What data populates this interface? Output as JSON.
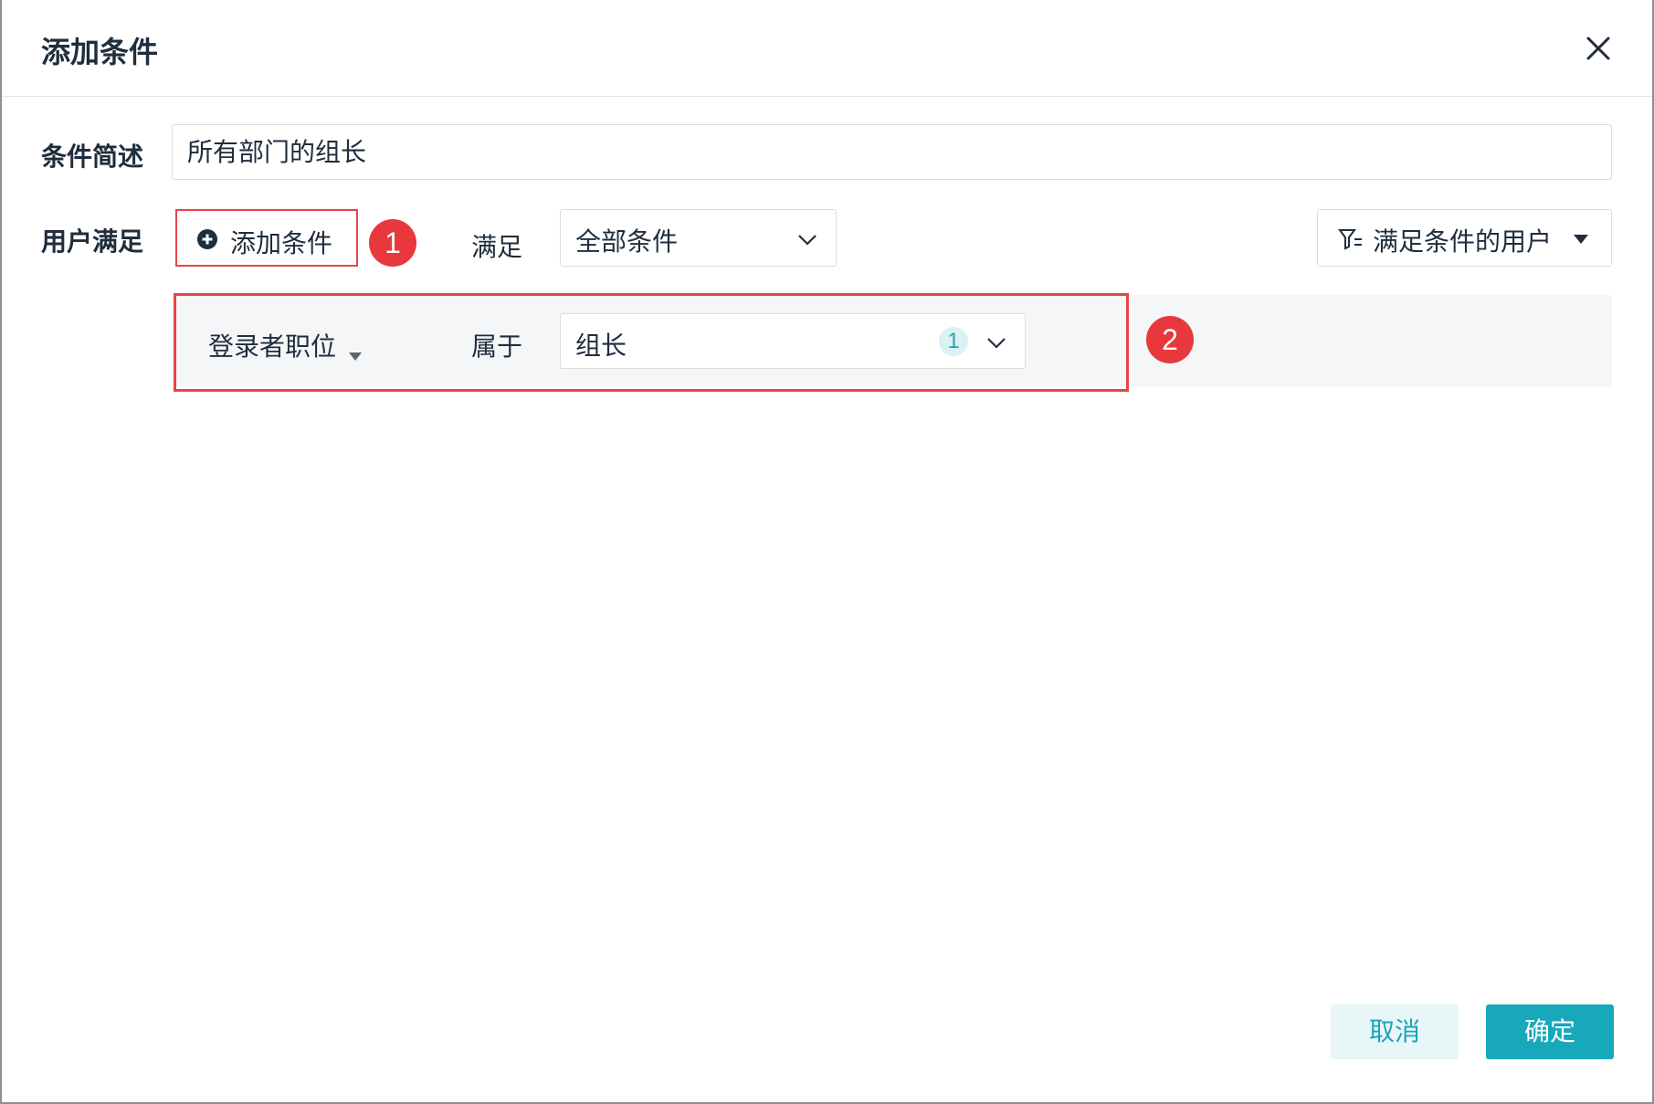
{
  "dialog": {
    "title": "添加条件",
    "close_icon": "close-icon"
  },
  "form": {
    "description_label": "条件简述",
    "description_value": "所有部门的组长",
    "user_satisfy_label": "用户满足",
    "add_condition_label": "添加条件",
    "satisfy_text": "满足",
    "match_mode_value": "全部条件",
    "filter_users_label": "满足条件的用户"
  },
  "condition": {
    "field": "登录者职位",
    "operator": "属于",
    "value": "组长",
    "count": "1"
  },
  "annotations": {
    "badge1": "1",
    "badge2": "2"
  },
  "footer": {
    "cancel_label": "取消",
    "confirm_label": "确定"
  },
  "colors": {
    "accent": "#17a8bc",
    "highlight": "#e64545",
    "badge": "#e8383d"
  }
}
